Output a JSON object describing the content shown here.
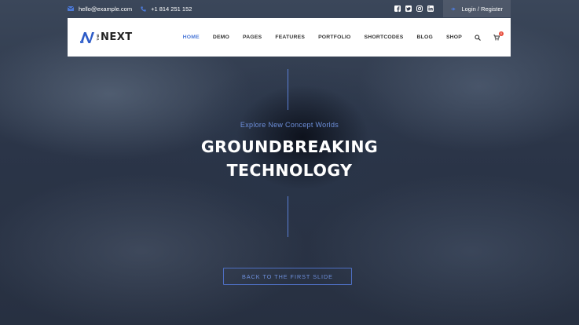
{
  "topbar": {
    "email": "hello@example.com",
    "phone": "+1 814 251 152",
    "social": [
      "facebook-icon",
      "twitter-icon",
      "instagram-icon",
      "linkedin-icon"
    ],
    "login_label": "Login / Register"
  },
  "brand": {
    "logo_small": "THE",
    "logo_text": "NEXT"
  },
  "nav": {
    "items": [
      {
        "label": "HOME",
        "active": true
      },
      {
        "label": "DEMO"
      },
      {
        "label": "PAGES"
      },
      {
        "label": "FEATURES"
      },
      {
        "label": "PORTFOLIO"
      },
      {
        "label": "SHORTCODES"
      },
      {
        "label": "BLOG"
      },
      {
        "label": "SHOP"
      }
    ],
    "cart_count": "0"
  },
  "hero": {
    "eyebrow": "Explore New Concept Worlds",
    "title_line1": "GROUNDBREAKING",
    "title_line2": "TECHNOLOGY",
    "cta_label": "BACK TO THE FIRST SLIDE"
  },
  "colors": {
    "accent": "#4d7ad8",
    "hero_overlay": "#2b3548",
    "cart_badge": "#e74c3c"
  }
}
